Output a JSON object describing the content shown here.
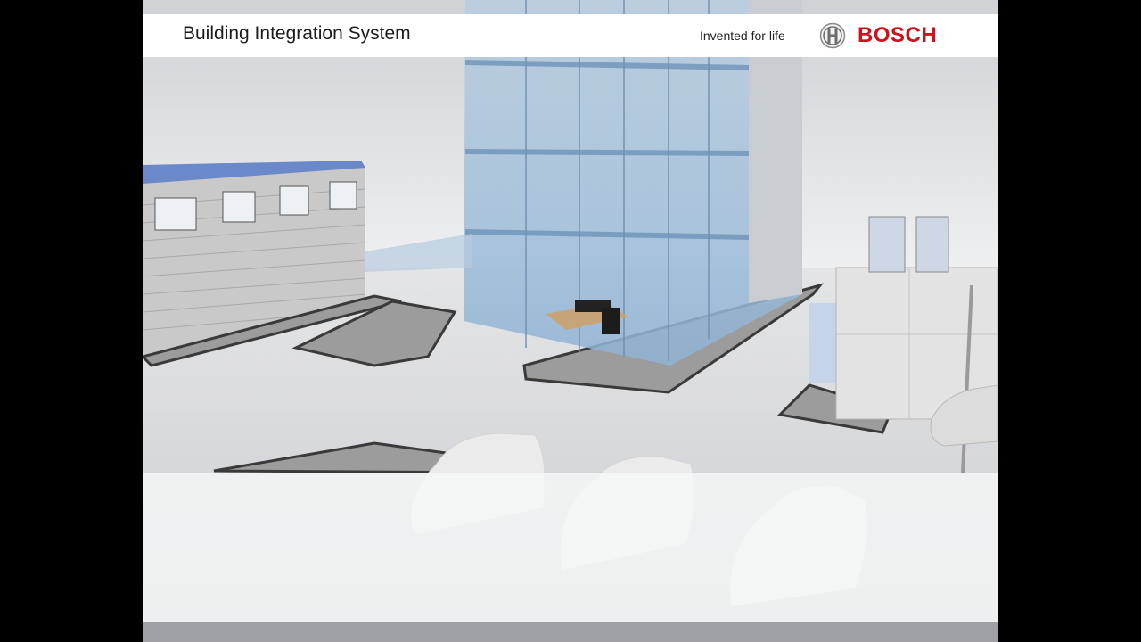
{
  "header": {
    "title": "Building Integration System",
    "tagline": "Invented for life",
    "brand": "BOSCH"
  },
  "colors": {
    "brand_red": "#d0101c",
    "header_bg": "#ffffff",
    "glass_blue": "#8fb3d4"
  },
  "icons": {
    "brand_mark": "bosch-armature-icon"
  }
}
